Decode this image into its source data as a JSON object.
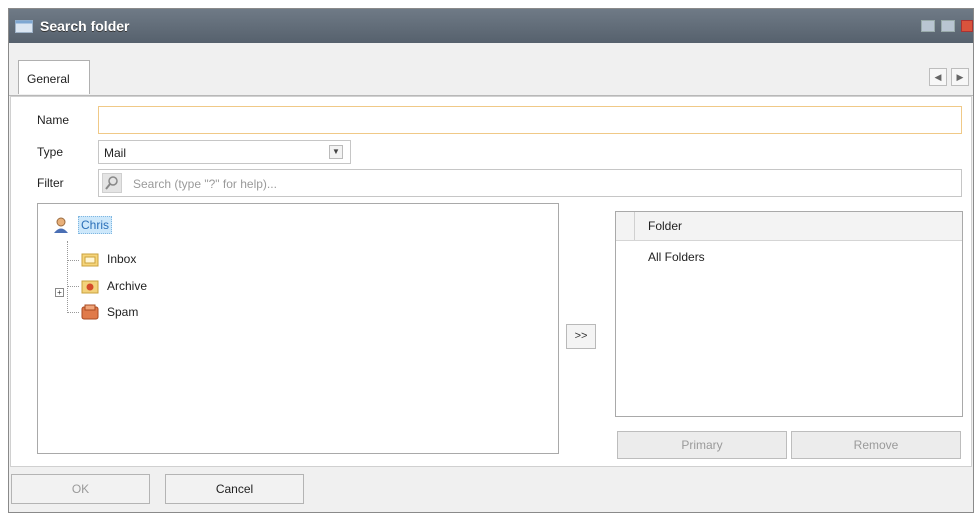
{
  "window": {
    "title": "Search folder",
    "title_icon": "folder-window-icon"
  },
  "window_controls": {
    "minimize_icon": "minimize-icon",
    "maximize_icon": "maximize-icon",
    "close_icon": "close-icon"
  },
  "tabs": [
    {
      "label": "General",
      "selected": true
    }
  ],
  "tab_nav": {
    "prev_glyph": "◀",
    "next_glyph": "▶"
  },
  "form": {
    "name_label": "Name",
    "name_value": "",
    "type_label": "Type",
    "type_value": "Mail",
    "filter_label": "Filter",
    "filter_placeholder": "Search (type \"?\" for help)..."
  },
  "tree": {
    "root": {
      "label": "Chris",
      "icon": "user-icon"
    },
    "children": [
      {
        "label": "Inbox",
        "icon": "inbox-folder-icon"
      },
      {
        "label": "Archive",
        "icon": "archive-folder-icon",
        "expandable": true
      },
      {
        "label": "Spam",
        "icon": "spam-folder-icon"
      }
    ]
  },
  "move_button": {
    "label": ">>"
  },
  "folder_grid": {
    "header": "Folder",
    "rows": [
      "All Folders"
    ]
  },
  "grid_buttons": {
    "primary_label": "Primary",
    "remove_label": "Remove"
  },
  "footer": {
    "ok_label": "OK",
    "cancel_label": "Cancel"
  },
  "colors": {
    "titlebar": "#5f6a76",
    "name_field_border": "#f0c987",
    "selection_bg": "#cde8fb",
    "close_button": "#d9533c"
  }
}
